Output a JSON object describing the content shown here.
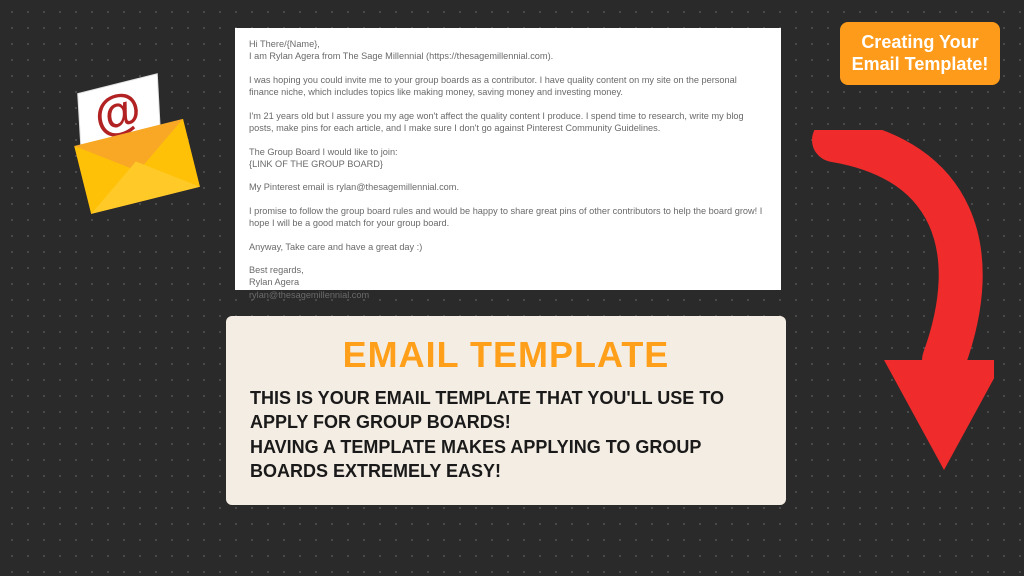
{
  "badge": {
    "line1": "Creating Your",
    "line2": "Email Template!"
  },
  "email": {
    "greeting": "Hi There/{Name},",
    "intro": "I am Rylan Agera from The Sage Millennial (https://thesagemillennial.com).",
    "para1": "I was hoping you could invite me to your group boards as a contributor. I have quality content on my site on the personal finance niche, which includes topics like making money, saving money and investing money.",
    "para2": "I'm 21 years old but I assure you my age won't affect the quality content I produce. I spend time to research, write my blog posts, make pins for each article, and I make sure I don't go against Pinterest Community Guidelines.",
    "join_line": "The Group Board I would like to join:",
    "join_placeholder": "{LINK OF THE GROUP BOARD}",
    "pinterest_email": "My Pinterest email is rylan@thesagemillennial.com.",
    "promise": "I promise to follow the group board rules and would be happy to share great pins of other contributors to help the board grow! I hope I will be a good match for your group board.",
    "closing": "Anyway, Take care and have a great day :)",
    "signoff": "Best regards,",
    "name": "Rylan Agera",
    "sender_email": "rylan@thesagemillennial.com"
  },
  "caption": {
    "title": "EMAIL TEMPLATE",
    "line1": "THIS IS YOUR EMAIL TEMPLATE THAT YOU'LL USE TO APPLY FOR GROUP BOARDS!",
    "line2": "HAVING A TEMPLATE MAKES APPLYING TO GROUP BOARDS EXTREMELY EASY!"
  },
  "colors": {
    "accent": "#ff9b1a",
    "arrow": "#e53935",
    "envelope": "#ffc107"
  }
}
